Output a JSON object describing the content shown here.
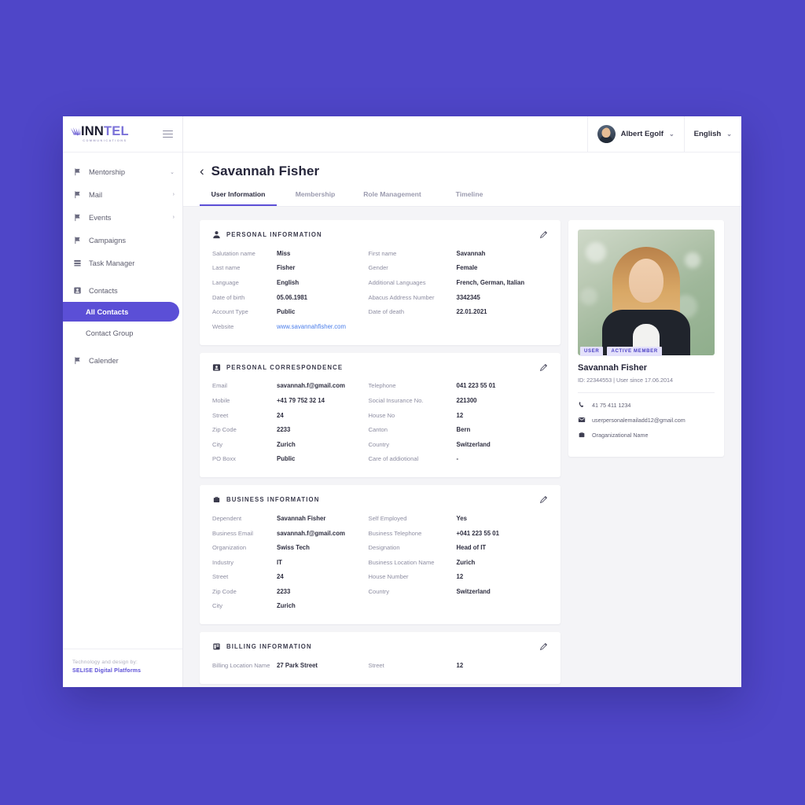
{
  "brand": {
    "name_part1": "INN",
    "name_part2": "TEL",
    "subtitle": "COMMUNICATIONS",
    "menu_icon": "hamburger-icon"
  },
  "sidebar": {
    "items": [
      {
        "label": "Mentorship",
        "icon": "flag-icon",
        "chevron": "⌄",
        "type": "parent",
        "active": false
      },
      {
        "label": "Mail",
        "icon": "flag-icon",
        "chevron": "›",
        "type": "parent",
        "active": false
      },
      {
        "label": "Events",
        "icon": "flag-icon",
        "chevron": "›",
        "type": "parent",
        "active": false
      },
      {
        "label": "Campaigns",
        "icon": "flag-icon",
        "chevron": "",
        "type": "item",
        "active": false
      },
      {
        "label": "Task Manager",
        "icon": "list-icon",
        "chevron": "",
        "type": "item",
        "active": false
      },
      {
        "label": "Contacts",
        "icon": "contact-card-icon",
        "chevron": "",
        "type": "item",
        "active": false
      },
      {
        "label": "All Contacts",
        "icon": "",
        "chevron": "",
        "type": "sub",
        "active": true
      },
      {
        "label": "Contact Group",
        "icon": "",
        "chevron": "",
        "type": "sub",
        "active": false
      },
      {
        "label": "Calender",
        "icon": "flag-icon",
        "chevron": "",
        "type": "item",
        "active": false
      }
    ],
    "footer_line1": "Technology and design by:",
    "footer_line2": "SELISE Digital Platforms"
  },
  "topbar": {
    "user_name": "Albert Egolf",
    "user_caret": "⌄",
    "language": "English",
    "language_caret": "⌄"
  },
  "page": {
    "back_icon": "‹",
    "title": "Savannah Fisher",
    "tabs": [
      {
        "label": "User Information",
        "active": true
      },
      {
        "label": "Membership",
        "active": false
      },
      {
        "label": "Role Management",
        "active": false
      },
      {
        "label": "Timeline",
        "active": false
      }
    ]
  },
  "sections": {
    "personal_information": {
      "title": "PERSONAL INFORMATION",
      "icon": "person-icon",
      "edit_icon": "pencil-icon",
      "rows": [
        {
          "l1": "Salutation name",
          "v1": "Miss",
          "l2": "First name",
          "v2": "Savannah"
        },
        {
          "l1": "Last name",
          "v1": "Fisher",
          "l2": "Gender",
          "v2": "Female"
        },
        {
          "l1": "Language",
          "v1": "English",
          "l2": "Additional Languages",
          "v2": "French, German, Italian"
        },
        {
          "l1": "Date of birth",
          "v1": "05.06.1981",
          "l2": "Abacus Address Number",
          "v2": "3342345"
        },
        {
          "l1": "Account Type",
          "v1": "Public",
          "l2": "Date of death",
          "v2": "22.01.2021"
        },
        {
          "l1": "Website",
          "v1": "www.savannahfisher.com",
          "v1_link": true,
          "l2": "",
          "v2": ""
        }
      ]
    },
    "personal_correspondence": {
      "title": "PERSONAL CORRESPONDENCE",
      "icon": "contact-card-icon",
      "edit_icon": "pencil-icon",
      "rows": [
        {
          "l1": "Email",
          "v1": "savannah.f@gmail.com",
          "l2": "Telephone",
          "v2": "041 223 55 01"
        },
        {
          "l1": "Mobile",
          "v1": "+41 79 752 32 14",
          "l2": "Social Insurance No.",
          "v2": "221300"
        },
        {
          "l1": "Street",
          "v1": "24",
          "l2": "House No",
          "v2": "12"
        },
        {
          "l1": "Zip Code",
          "v1": "2233",
          "l2": "Canton",
          "v2": "Bern"
        },
        {
          "l1": "City",
          "v1": "Zurich",
          "l2": "Country",
          "v2": "Switzerland"
        },
        {
          "l1": "PO Boxx",
          "v1": "Public",
          "l2": "Care of addiotional",
          "v2": "-"
        }
      ]
    },
    "business_information": {
      "title": "BUSINESS INFORMATION",
      "icon": "briefcase-icon",
      "edit_icon": "pencil-icon",
      "rows": [
        {
          "l1": "Dependent",
          "v1": "Savannah Fisher",
          "l2": "Self Employed",
          "v2": "Yes"
        },
        {
          "l1": "Business Email",
          "v1": "savannah.f@gmail.com",
          "l2": "Business Telephone",
          "v2": "+041 223 55 01"
        },
        {
          "l1": "Organization",
          "v1": "Swiss Tech",
          "l2": "Designation",
          "v2": "Head of IT"
        },
        {
          "l1": "Industry",
          "v1": "IT",
          "l2": "Business Location Name",
          "v2": "Zurich"
        },
        {
          "l1": "Street",
          "v1": "24",
          "l2": "House Number",
          "v2": "12"
        },
        {
          "l1": "Zip Code",
          "v1": "2233",
          "l2": "Country",
          "v2": "Switzerland"
        },
        {
          "l1": "City",
          "v1": "Zurich",
          "l2": "",
          "v2": ""
        }
      ]
    },
    "billing_information": {
      "title": "BILLING INFORMATION",
      "icon": "billing-icon",
      "edit_icon": "pencil-icon",
      "rows": [
        {
          "l1": "Billing Location Name",
          "v1": "27 Park Street",
          "l2": "Street",
          "v2": "12"
        }
      ]
    }
  },
  "profile": {
    "photo_alt": "profile-photo",
    "badges": [
      "USER",
      "ACTIVE MEMBER"
    ],
    "name": "Savannah Fisher",
    "meta": "ID: 22344553  |  User since 17.06.2014",
    "contacts": [
      {
        "icon": "phone-icon",
        "text": "41 75 411 1234"
      },
      {
        "icon": "envelope-icon",
        "text": "userpersonalemailadd12@gmail.com"
      },
      {
        "icon": "briefcase-icon",
        "text": "Oraganizational Name"
      }
    ]
  },
  "colors": {
    "page_background": "#4f46c8",
    "accent": "#5b4fd6",
    "badge_background": "#e4e1fb",
    "badge_text": "#4b40c4",
    "link": "#4a7dea",
    "content_background": "#f4f4f7"
  }
}
